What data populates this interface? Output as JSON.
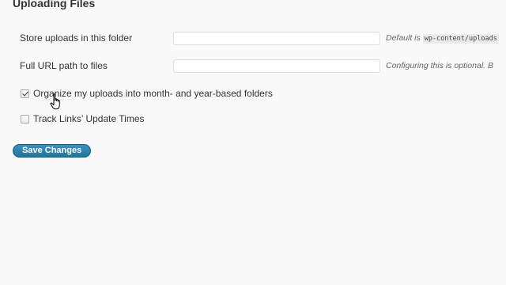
{
  "section": {
    "title": "Uploading Files"
  },
  "upload_path": {
    "label": "Store uploads in this folder",
    "value": "",
    "description_prefix": "Default is",
    "description_code": "wp-content/uploads"
  },
  "upload_url": {
    "label": "Full URL path to files",
    "value": "",
    "description": "Configuring this is optional. B"
  },
  "options": [
    {
      "label": "Organize my uploads into month- and year-based folders",
      "checked": true
    },
    {
      "label": "Track Links’ Update Times",
      "checked": false
    }
  ],
  "save_button": {
    "label": "Save Changes"
  },
  "colors": {
    "page_background": "#f9f9f9",
    "button_blue": "#21759b",
    "text": "#333333",
    "description_text": "#666666"
  },
  "icons": {
    "cursor": "hand-pointer-icon"
  }
}
